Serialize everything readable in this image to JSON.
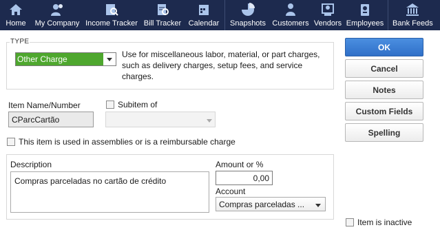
{
  "toolbar": {
    "items": [
      {
        "label": "Home",
        "icon": "home-icon"
      },
      {
        "label": "My Company",
        "icon": "company-icon"
      },
      {
        "label": "Income Tracker",
        "icon": "income-tracker-icon"
      },
      {
        "label": "Bill Tracker",
        "icon": "bill-tracker-icon"
      },
      {
        "label": "Calendar",
        "icon": "calendar-icon"
      },
      {
        "label": "Snapshots",
        "icon": "pie-chart-icon"
      },
      {
        "label": "Customers",
        "icon": "customer-icon"
      },
      {
        "label": "Vendors",
        "icon": "vendor-icon"
      },
      {
        "label": "Employees",
        "icon": "employee-icon"
      },
      {
        "label": "Bank Feeds",
        "icon": "bank-icon"
      }
    ]
  },
  "type": {
    "legend": "TYPE",
    "selected": "Other Charge",
    "description": "Use for miscellaneous labor, material, or part charges, such as delivery charges, setup fees, and service charges."
  },
  "buttons": {
    "ok": "OK",
    "cancel": "Cancel",
    "notes": "Notes",
    "custom_fields": "Custom Fields",
    "spelling": "Spelling"
  },
  "item": {
    "name_label": "Item Name/Number",
    "name_value": "CParcCartão",
    "subitem_label": "Subitem of",
    "subitem_value": "",
    "assemblies_label": "This item is used in assemblies or is a reimbursable charge"
  },
  "details": {
    "description_label": "Description",
    "description_value": "Compras parceladas no cartão de crédito",
    "amount_label": "Amount or %",
    "amount_value": "0,00",
    "account_label": "Account",
    "account_value": "Compras parceladas ..."
  },
  "inactive_label": "Item is inactive",
  "colors": {
    "toolbar_bg": "#1d2a4e",
    "type_selected_bg": "#4ea72e",
    "ok_button": "#2f6fc8"
  }
}
